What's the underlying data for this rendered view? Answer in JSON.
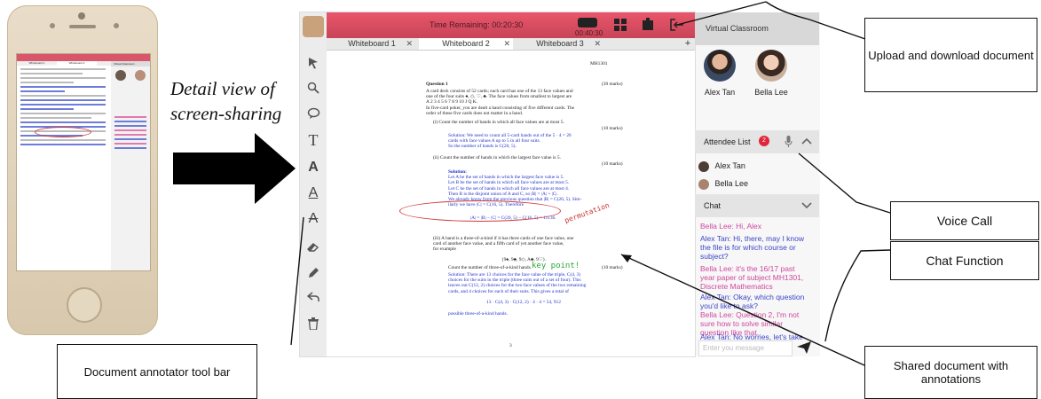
{
  "caption": {
    "detail_view": "Detail view of screen-sharing"
  },
  "phone": {
    "mini_header": "Time Remaining: 00:20:30",
    "mini_tab_1": "Whiteboard 1",
    "mini_tab_2": "Whiteboard 2",
    "mini_side_title": "Virtual Classroom"
  },
  "app": {
    "time_remaining": "Time Remaining: 00:20:30",
    "recording_timer": "00:40:30",
    "tabs": [
      {
        "label": "Whiteboard 1",
        "active": false
      },
      {
        "label": "Whiteboard 2",
        "active": true
      },
      {
        "label": "Whiteboard 3",
        "active": false
      }
    ],
    "add_tab": "+",
    "tools": [
      "select-arrow-icon",
      "zoom-icon",
      "comment-icon",
      "text-icon",
      "bold-icon",
      "underline-icon",
      "strikethrough-icon",
      "eraser-icon",
      "pen-icon",
      "undo-icon",
      "trash-icon"
    ]
  },
  "document": {
    "course": "MH1301",
    "q1_title": "Question 1",
    "q1_marks": "(30 marks)",
    "q1_intro": [
      "A card deck consists of 52 cards; each card has one of the 13 face values and",
      "one of the four suits ♠, ◇, ♡, ♣. The face values from smallest to largest are",
      "A 2 3 4 5 6 7 8 9 10 J Q K.",
      "In five-card poker, you are dealt a hand consisting of five different cards. The",
      "order of these five cards does not matter in a hand."
    ],
    "part_i": "(i) Count the number of hands in which all face values are at most 5.",
    "part_i_marks": "(10 marks)",
    "part_i_solution": [
      "Solution: We need to count all 5-card hands out of the 5 · 4 = 20",
      "cards with face values A up to 5 in all four suits.",
      "So the number of hands is C(20, 5)."
    ],
    "part_ii": "(ii) Count the number of hands in which the largest face value is 5.",
    "part_ii_marks": "(10 marks)",
    "part_ii_solution": [
      "Solution:",
      "Let A be the set of hands in which the largest face value is 5.",
      "Let B be the set of hands in which all face values are at most 5.",
      "Let C be the set of hands in which all face values are at most 4.",
      "Then B is the disjoint union of A and C, so |B| = |A| + |C|.",
      "We already know from the previous question that |B| = C(20, 5). Sim-",
      "ilarly we have |C| = C(16, 5). Therefore"
    ],
    "part_ii_formula": "|A| = |B| − |C| = C(20, 5) − C(16, 5) = 11136.",
    "annotation_permutation": "permutation",
    "part_iii": [
      "(iii) A hand is a three-of-a-kind if it has three cards of one face value, one",
      "card of another face value, and a fifth card of yet another face value,",
      "for example"
    ],
    "part_iii_example": "{9♠, 9♣, 9◇, A♣, 9♡}.",
    "part_iii_count": "Count the number of three-of-a-kind hands.",
    "part_iii_marks": "(10 marks)",
    "annotation_keypoint": "key point!",
    "part_iii_solution": [
      "Solution: There are 13 choices for the face value of the triple, C(4, 3)",
      "choices for the suits in the triple (three suits out of a set of four). This",
      "leaves out C(12, 2) choices for the two face values of the two remaining",
      "cards, and 4 choices for each of their suits. This gives a total of"
    ],
    "part_iii_formula": "13 · C(4, 3) · C(12, 2) · 4 · 4 = 54, 912",
    "part_iii_end": "possible three-of-a-kind hands.",
    "page_number": "3"
  },
  "sidebar": {
    "title": "Virtual Classroom",
    "participants": [
      {
        "name": "Alex Tan"
      },
      {
        "name": "Bella Lee"
      }
    ],
    "attendee_label": "Attendee List",
    "attendee_count": "2",
    "attendees": [
      "Alex Tan",
      "Bella Lee"
    ],
    "chat_label": "Chat",
    "messages": [
      {
        "text": "Bella Lee: Hi, Alex",
        "color": "#d0479e"
      },
      {
        "text": "Alex Tan: Hi, there, may I know the file is for which course or subject?",
        "color": "#3d46c8"
      },
      {
        "text": "Bella Lee: it's the 16/17 past year paper of subject MH1301, Discrete Mathematics",
        "color": "#d0479e"
      },
      {
        "text": "Alex Tan: Okay, which question you'd like to ask?",
        "color": "#3d46c8"
      },
      {
        "text": "Bella Lee: Question 2, I'm not sure how to solve similar question like that.",
        "color": "#d0479e"
      },
      {
        "text": "Alex Tan: No worries, let's take a look at the question, we have condition which is ...",
        "color": "#3d46c8"
      }
    ],
    "input_placeholder": "Enter you message"
  },
  "callouts": {
    "upload": "Upload and download document",
    "voice": "Voice Call",
    "chat": "Chat Function",
    "shared": "Shared document with annotations",
    "toolbar": "Document annotator tool bar"
  },
  "colors": {
    "topbar": "#d9506a",
    "record": "#e0263a",
    "self_blue": "#3d46c8",
    "peer_pink": "#d0479e"
  }
}
